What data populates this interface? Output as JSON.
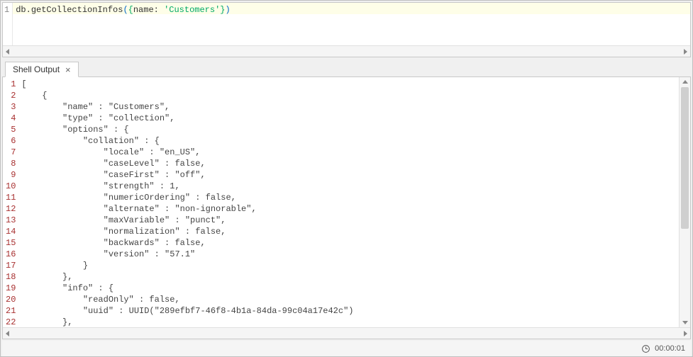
{
  "editor": {
    "lines": [
      "1"
    ],
    "command": {
      "obj": "db",
      "dot": ".",
      "method": "getCollectionInfos",
      "lp": "(",
      "lb": "{",
      "key": "name",
      "colon": ": ",
      "strq": "'Customers'",
      "rb": "}",
      "rp": ")"
    }
  },
  "tabs": {
    "output_label": "Shell Output"
  },
  "output": {
    "line_count": 22,
    "lines": [
      "[",
      "    {",
      "        \"name\" : \"Customers\",",
      "        \"type\" : \"collection\",",
      "        \"options\" : {",
      "            \"collation\" : {",
      "                \"locale\" : \"en_US\",",
      "                \"caseLevel\" : false,",
      "                \"caseFirst\" : \"off\",",
      "                \"strength\" : 1,",
      "                \"numericOrdering\" : false,",
      "                \"alternate\" : \"non-ignorable\",",
      "                \"maxVariable\" : \"punct\",",
      "                \"normalization\" : false,",
      "                \"backwards\" : false,",
      "                \"version\" : \"57.1\"",
      "            }",
      "        },",
      "        \"info\" : {",
      "            \"readOnly\" : false,",
      "            \"uuid\" : UUID(\"289efbf7-46f8-4b1a-84da-99c04a17e42c\")",
      "        },"
    ]
  },
  "status": {
    "elapsed": "00:00:01"
  }
}
